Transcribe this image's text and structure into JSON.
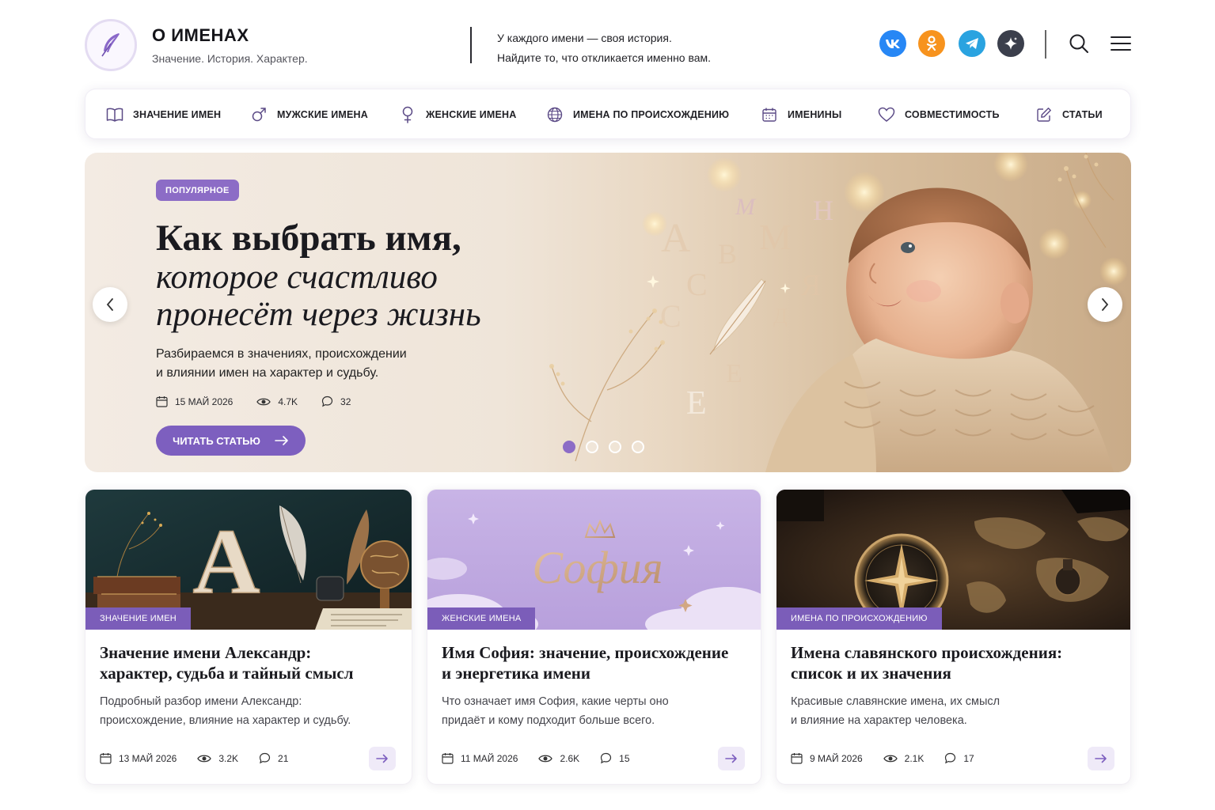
{
  "brand": {
    "title": "О ИМЕНАХ",
    "subtitle": "Значение. История. Характер.",
    "logo_icon": "feather-icon"
  },
  "tagline": {
    "line1": "У каждого имени — своя история.",
    "line2": "Найдите то, что откликается именно вам."
  },
  "social": [
    {
      "name": "vk",
      "label": "vk",
      "color": "#2787f5"
    },
    {
      "name": "odnoklassniki",
      "label": "ok",
      "color": "#f7931e"
    },
    {
      "name": "telegram",
      "label": "tg",
      "color": "#2aa3e0"
    },
    {
      "name": "sparkle",
      "label": "✦",
      "color": "#3b3f4c"
    }
  ],
  "nav": [
    {
      "label": "ЗНАЧЕНИЕ ИМЕН",
      "icon": "book-icon"
    },
    {
      "label": "МУЖСКИЕ ИМЕНА",
      "icon": "male-icon"
    },
    {
      "label": "ЖЕНСКИЕ ИМЕНА",
      "icon": "female-icon"
    },
    {
      "label": "ИМЕНА ПО ПРОИСХОЖДЕНИЮ",
      "icon": "globe-icon"
    },
    {
      "label": "ИМЕНИНЫ",
      "icon": "calendar-icon"
    },
    {
      "label": "СОВМЕСТИМОСТЬ",
      "icon": "heart-icon"
    },
    {
      "label": "СТАТЬИ",
      "icon": "edit-icon"
    }
  ],
  "hero": {
    "badge": "ПОПУЛЯРНОЕ",
    "title_line1": "Как выбрать имя,",
    "title_line2": "которое счастливо",
    "title_line3": "пронесёт через жизнь",
    "desc_line1": "Разбираемся в значениях, происхождении",
    "desc_line2": "и влиянии имен на характер и судьбу.",
    "date": "15 МАЙ 2026",
    "views": "4.7K",
    "comments": "32",
    "button": "ЧИТАТЬ СТАТЬЮ",
    "slides_total": 4,
    "active_slide": 1,
    "letters": [
      "А",
      "В",
      "М",
      "Я",
      "С",
      "С",
      "Е",
      "Д",
      "Н",
      "Е",
      "А"
    ]
  },
  "cards": [
    {
      "tag": "ЗНАЧЕНИЕ ИМЕН",
      "title_line1": "Значение имени Александр:",
      "title_line2": "характер, судьба и тайный смысл",
      "desc_line1": "Подробный разбор имени Александр:",
      "desc_line2": "происхождение, влияние на характер и судьбу.",
      "date": "13 МАЙ 2026",
      "views": "3.2K",
      "comments": "21",
      "image_letter": "A"
    },
    {
      "tag": "ЖЕНСКИЕ ИМЕНА",
      "title_line1": "Имя София: значение, происхождение",
      "title_line2": "и энергетика имени",
      "desc_line1": "Что означает имя София, какие черты оно",
      "desc_line2": "придаёт и кому подходит больше всего.",
      "date": "11 МАЙ 2026",
      "views": "2.6K",
      "comments": "15",
      "image_text": "София"
    },
    {
      "tag": "ИМЕНА ПО ПРОИСХОЖДЕНИЮ",
      "title_line1": "Имена славянского происхождения:",
      "title_line2": "список и их значения",
      "desc_line1": "Красивые славянские имена, их смысл",
      "desc_line2": "и влияние на характер человека.",
      "date": "9 МАЙ 2026",
      "views": "2.1K",
      "comments": "17"
    }
  ],
  "colors": {
    "accent": "#7d5fbf",
    "accent_light": "#efeaf8"
  }
}
